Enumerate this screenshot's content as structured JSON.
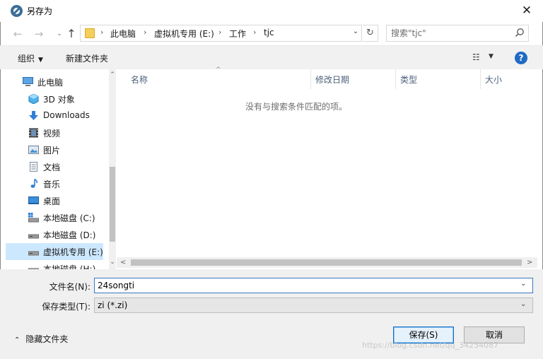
{
  "window": {
    "title": "另存为",
    "close_label": "✕"
  },
  "nav": {
    "back_label": "←",
    "forward_label": "→",
    "recent_label": "⌄",
    "up_label": "↑"
  },
  "address": {
    "crumbs": [
      "此电脑",
      "虚拟机专用 (E:)",
      "工作",
      "tjc"
    ],
    "separator": "›",
    "dropdown_label": "⌄",
    "refresh_label": "↻"
  },
  "search": {
    "placeholder": "搜索\"tjc\""
  },
  "toolbar": {
    "organize_label": "组织",
    "organize_caret": "▼",
    "new_folder_label": "新建文件夹",
    "view_label": "☷",
    "view_caret": "▼",
    "help_label": "?"
  },
  "sidebar": {
    "items": [
      {
        "label": "此电脑",
        "icon": "computer-icon"
      },
      {
        "label": "3D 对象",
        "icon": "3d-objects-icon"
      },
      {
        "label": "Downloads",
        "icon": "download-icon"
      },
      {
        "label": "视频",
        "icon": "video-icon"
      },
      {
        "label": "图片",
        "icon": "picture-icon"
      },
      {
        "label": "文档",
        "icon": "document-icon"
      },
      {
        "label": "音乐",
        "icon": "music-icon"
      },
      {
        "label": "桌面",
        "icon": "desktop-icon"
      },
      {
        "label": "本地磁盘 (C:)",
        "icon": "system-drive-icon"
      },
      {
        "label": "本地磁盘 (D:)",
        "icon": "drive-icon"
      },
      {
        "label": "虚拟机专用 (E:)",
        "icon": "drive-icon"
      },
      {
        "label": "本地磁盘 (H:)",
        "icon": "drive-icon"
      }
    ],
    "selected_index": 10,
    "scroll_up": "⌃",
    "scroll_down": "⌄"
  },
  "file_list": {
    "columns": [
      "名称",
      "修改日期",
      "类型",
      "大小"
    ],
    "sort_indicator": "^",
    "empty_message": "没有与搜索条件匹配的项。",
    "scroll_left": "<",
    "scroll_right": ">"
  },
  "form": {
    "filename_label": "文件名(N):",
    "filename_value": "24songti",
    "filetype_label": "保存类型(T):",
    "filetype_value": "zi (*.zi)",
    "caret": "⌄",
    "hide_folders_label": "隐藏文件夹",
    "hide_folders_caret": "⌃",
    "save_label": "保存(S)",
    "cancel_label": "取消"
  },
  "watermark": "https://blog.csdn.net/qq_34234087"
}
